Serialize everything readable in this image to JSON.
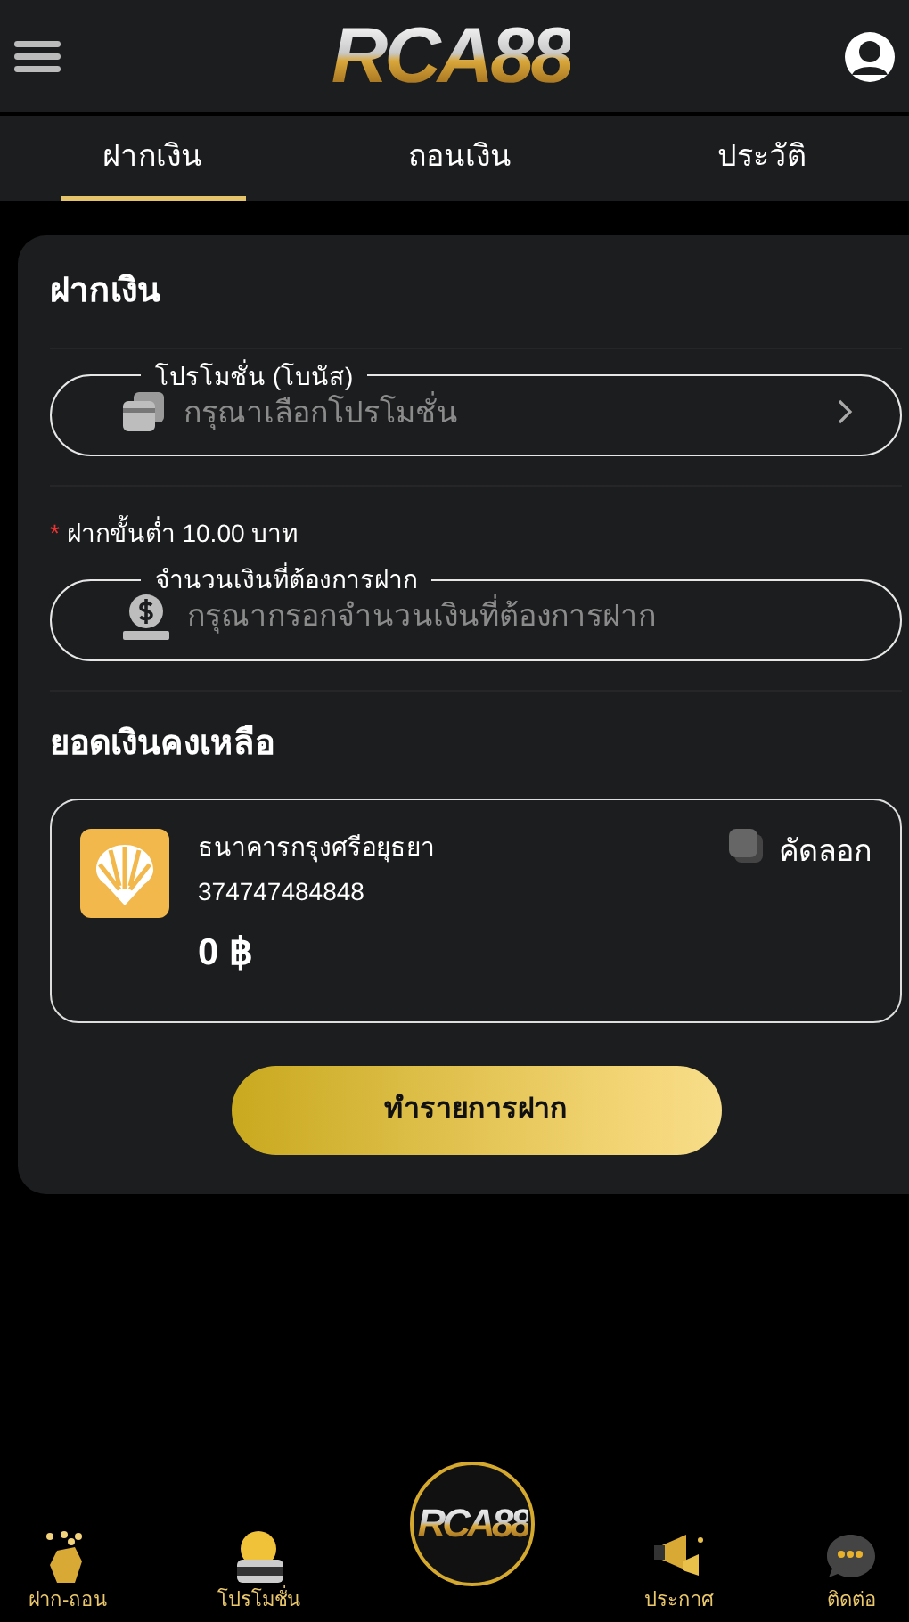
{
  "header": {
    "logo": "RCA88"
  },
  "tabs": [
    {
      "label": "ฝากเงิน",
      "selected": true
    },
    {
      "label": "ถอนเงิน",
      "selected": false
    },
    {
      "label": "ประวัติ",
      "selected": false
    }
  ],
  "panel": {
    "title": "ฝากเงิน",
    "promotion": {
      "label": "โปรโมชั่น (โบนัส)",
      "placeholder": "กรุณาเลือกโปรโมชั่น"
    },
    "minimum_note": {
      "required_mark": "*",
      "text": "ฝากขั้นต่ำ 10.00 บาท"
    },
    "amount": {
      "label": "จำนวนเงินที่ต้องการฝาก",
      "placeholder": "กรุณากรอกจำนวนเงินที่ต้องการฝาก"
    },
    "balance_title": "ยอดเงินคงเหลือ",
    "account": {
      "bank_name": "ธนาคารกรุงศรีอยุธยา",
      "account_number": "374747484848",
      "balance": "0 ฿",
      "copy_label": "คัดลอก"
    },
    "submit": "ทำรายการฝาก"
  },
  "bottom_nav": [
    {
      "kind": "item",
      "label": "ฝาก-ถอน"
    },
    {
      "kind": "item",
      "label": "โปรโมชั่น"
    },
    {
      "kind": "logo",
      "label": "RCA88"
    },
    {
      "kind": "item",
      "label": "ประกาศ"
    },
    {
      "kind": "item",
      "label": "ติดต่อ"
    }
  ]
}
